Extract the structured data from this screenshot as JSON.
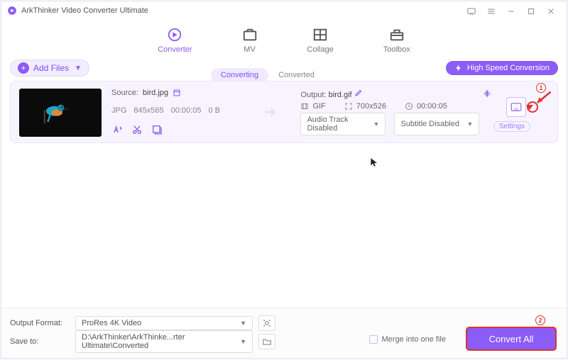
{
  "app": {
    "title": "ArkThinker Video Converter Ultimate"
  },
  "tabs": {
    "converter": "Converter",
    "mv": "MV",
    "collage": "Collage",
    "toolbox": "Toolbox"
  },
  "toolbar": {
    "add_files": "Add Files",
    "converting": "Converting",
    "converted": "Converted",
    "high_speed": "High Speed Conversion"
  },
  "file": {
    "source_label": "Source:",
    "source_name": "bird.jpg",
    "src_format": "JPG",
    "src_res": "845x565",
    "src_dur": "00:00:05",
    "src_size": "0 B",
    "output_label": "Output:",
    "output_name": "bird.gif",
    "out_format": "GIF",
    "out_res": "700x526",
    "out_dur": "00:00:05",
    "audio_track": "Audio Track Disabled",
    "subtitle": "Subtitle Disabled",
    "settings": "Settings",
    "fmt_badge": "GIF"
  },
  "footer": {
    "output_format_label": "Output Format:",
    "output_format_value": "ProRes 4K Video",
    "save_to_label": "Save to:",
    "save_to_value": "D:\\ArkThinker\\ArkThinke...rter Ultimate\\Converted",
    "merge": "Merge into one file",
    "convert": "Convert All"
  },
  "ann": {
    "b1": "1",
    "b2": "2"
  }
}
